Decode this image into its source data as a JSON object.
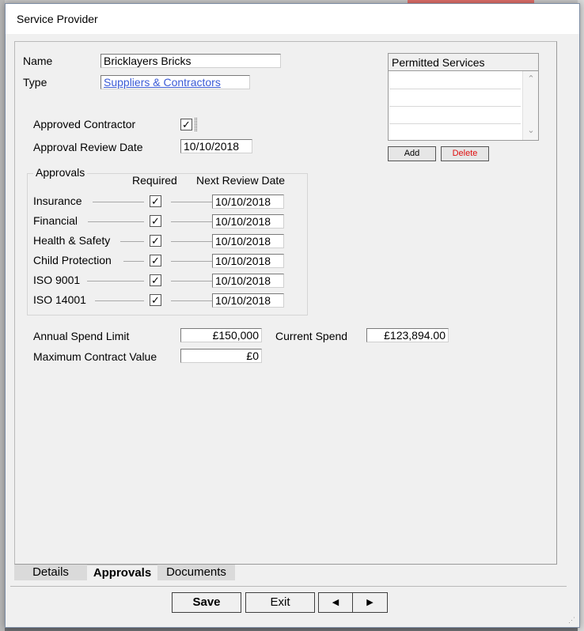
{
  "window": {
    "title": "Service Provider"
  },
  "provider": {
    "name_label": "Name",
    "name_value": "Bricklayers Bricks",
    "type_label": "Type",
    "type_value": "Suppliers & Contractors"
  },
  "approval": {
    "approved_contractor_label": "Approved Contractor",
    "approved_contractor_checked": true,
    "review_date_label": "Approval Review Date",
    "review_date_value": "10/10/2018"
  },
  "approvals_group": {
    "title": "Approvals",
    "col_required": "Required",
    "col_next_review": "Next Review Date",
    "check_glyph": "✓",
    "rows": [
      {
        "label": "Insurance",
        "required": true,
        "date": "10/10/2018"
      },
      {
        "label": "Financial",
        "required": true,
        "date": "10/10/2018"
      },
      {
        "label": "Health & Safety",
        "required": true,
        "date": "10/10/2018"
      },
      {
        "label": "Child Protection",
        "required": true,
        "date": "10/10/2018"
      },
      {
        "label": "ISO 9001",
        "required": true,
        "date": "10/10/2018"
      },
      {
        "label": "ISO 14001",
        "required": true,
        "date": "10/10/2018"
      }
    ]
  },
  "spend": {
    "annual_limit_label": "Annual Spend Limit",
    "annual_limit_value": "£150,000",
    "current_spend_label": "Current Spend",
    "current_spend_value": "£123,894.00",
    "max_contract_label": "Maximum Contract Value",
    "max_contract_value": "£0"
  },
  "permitted_services": {
    "header": "Permitted Services",
    "items": [],
    "add_label": "Add",
    "delete_label": "Delete",
    "delete_color": "#e01010"
  },
  "tabs": [
    {
      "label": "Details",
      "active": false
    },
    {
      "label": "Approvals",
      "active": true
    },
    {
      "label": "Documents",
      "active": false
    }
  ],
  "footer": {
    "save_label": "Save",
    "exit_label": "Exit",
    "prev_label": "◀",
    "next_label": "▶"
  }
}
